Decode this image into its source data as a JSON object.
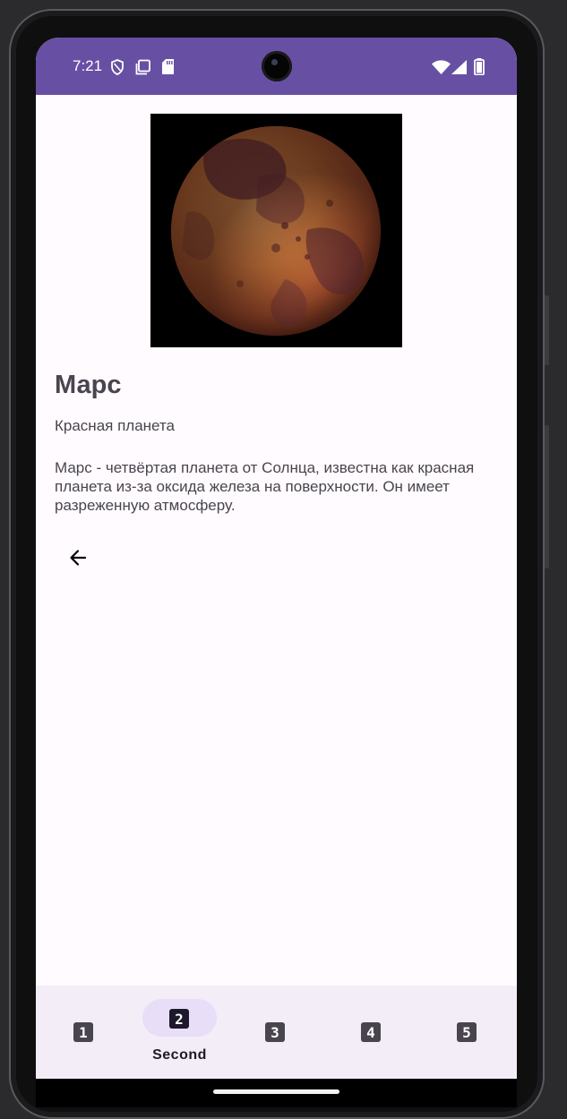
{
  "status_bar": {
    "time": "7:21",
    "left_icons": [
      "shield-icon",
      "screenshot-icon",
      "sd-card-icon"
    ],
    "right_icons": [
      "wifi-icon",
      "cell-signal-icon",
      "battery-icon"
    ],
    "background": "#6750a4"
  },
  "content": {
    "image_alt": "mars-planet",
    "title": "Марс",
    "subtitle": "Красная планета",
    "description": "Марс - четвёртая планета от Солнца, известна как красная планета из-за оксида железа на поверхности. Он имеет разреженную атмосферу.",
    "back_icon": "arrow-back-icon"
  },
  "bottom_nav": {
    "selected_index": 1,
    "items": [
      {
        "glyph": "1",
        "label": ""
      },
      {
        "glyph": "2",
        "label": "Second"
      },
      {
        "glyph": "3",
        "label": ""
      },
      {
        "glyph": "4",
        "label": ""
      },
      {
        "glyph": "5",
        "label": ""
      }
    ],
    "background": "#f3edf7",
    "indicator_color": "#e8def8"
  }
}
